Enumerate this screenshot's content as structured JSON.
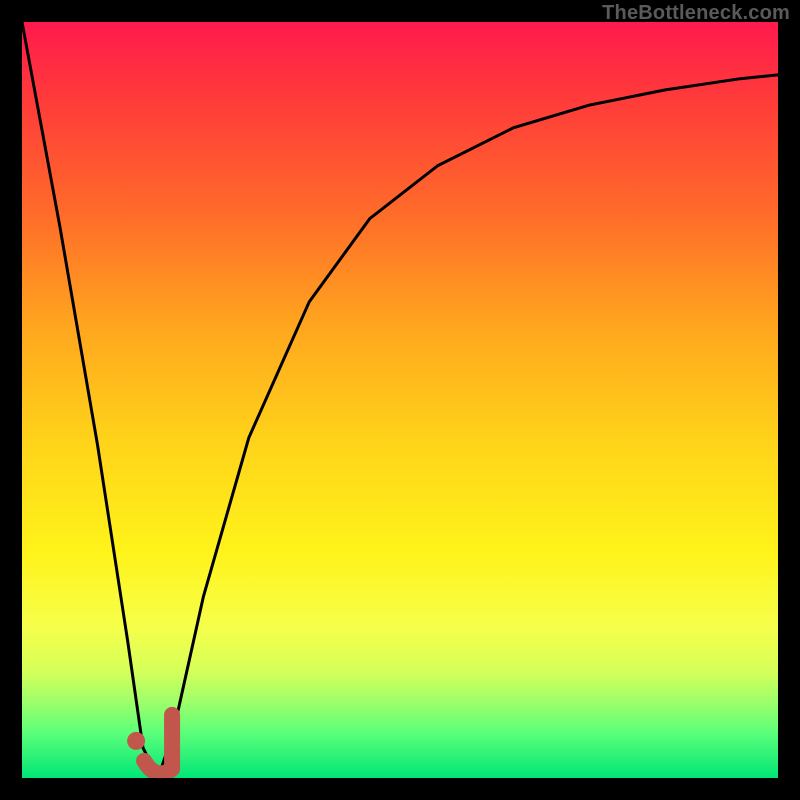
{
  "watermark": "TheBottleneck.com",
  "colors": {
    "frame": "#000000",
    "curve": "#000000",
    "marker": "#c1564d",
    "gradient_top": "#ff1a4d",
    "gradient_bottom": "#00e676"
  },
  "chart_data": {
    "type": "line",
    "title": "",
    "xlabel": "",
    "ylabel": "",
    "xlim": [
      0,
      100
    ],
    "ylim": [
      0,
      100
    ],
    "series": [
      {
        "name": "bottleneck-curve",
        "x": [
          0,
          5,
          10,
          14,
          16,
          18,
          20,
          24,
          30,
          38,
          46,
          55,
          65,
          75,
          85,
          95,
          100
        ],
        "values": [
          100,
          73,
          44,
          18,
          4,
          0,
          6,
          24,
          45,
          63,
          74,
          81,
          86,
          89,
          91,
          92.5,
          93
        ]
      }
    ],
    "marker": {
      "shape": "J",
      "color": "#c1564d",
      "x": 18,
      "y": 2
    }
  }
}
